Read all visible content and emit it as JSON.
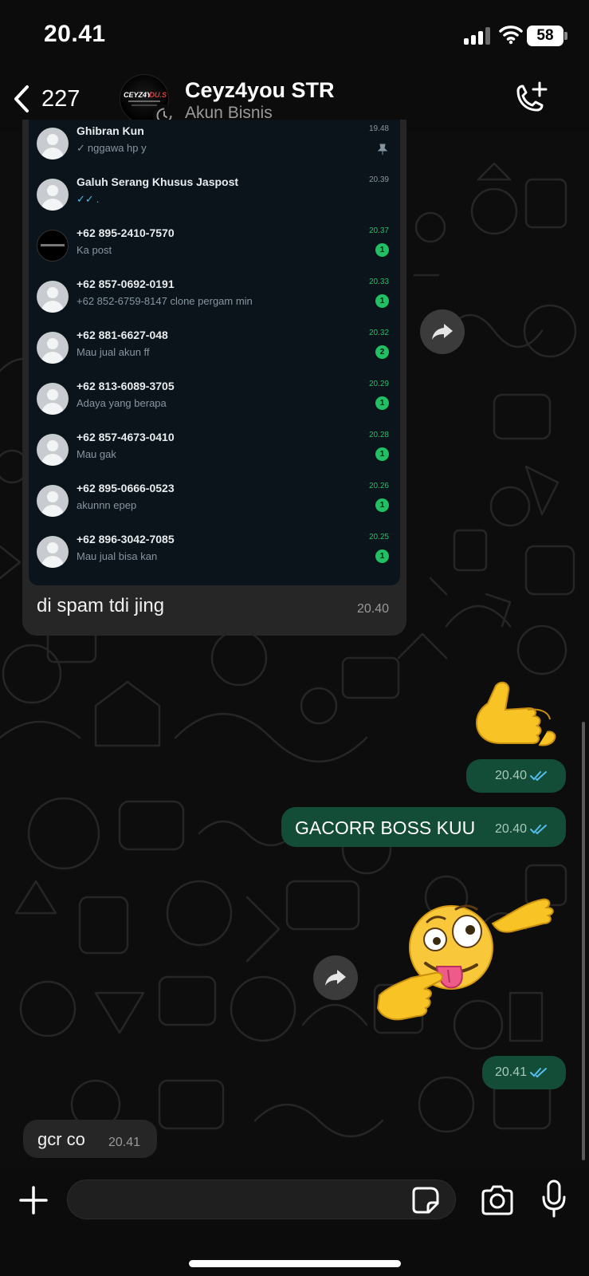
{
  "status_bar": {
    "time": "20.41",
    "battery": "58"
  },
  "header": {
    "back_count": "227",
    "contact_name": "Ceyz4you STR",
    "contact_subtitle": "Akun Bisnis"
  },
  "incoming_image": {
    "rows": [
      {
        "name": "Ghibran Kun",
        "tick": "✓",
        "message": "nggawa hp y",
        "time": "19.48",
        "badge": "",
        "pinned": true,
        "avatar": "default"
      },
      {
        "name": "Galuh Serang Khusus Jaspost",
        "tick": "✓✓",
        "message": ".",
        "time": "20.39",
        "badge": "",
        "pinned": false,
        "avatar": "default"
      },
      {
        "name": "+62 895-2410-7570",
        "tick": "",
        "message": "Ka post",
        "time": "20.37",
        "badge": "1",
        "pinned": false,
        "avatar": "logo"
      },
      {
        "name": "+62 857-0692-0191",
        "tick": "",
        "message": "+62 852-6759-8147 clone pergam min",
        "time": "20.33",
        "badge": "1",
        "pinned": false,
        "avatar": "default"
      },
      {
        "name": "+62 881-6627-048",
        "tick": "",
        "message": "Mau jual akun ff",
        "time": "20.32",
        "badge": "2",
        "pinned": false,
        "avatar": "default"
      },
      {
        "name": "+62 813-6089-3705",
        "tick": "",
        "message": "Adaya yang berapa",
        "time": "20.29",
        "badge": "1",
        "pinned": false,
        "avatar": "default"
      },
      {
        "name": "+62 857-4673-0410",
        "tick": "",
        "message": "Mau gak",
        "time": "20.28",
        "badge": "1",
        "pinned": false,
        "avatar": "default"
      },
      {
        "name": "+62 895-0666-0523",
        "tick": "",
        "message": "akunnn epep",
        "time": "20.26",
        "badge": "1",
        "pinned": false,
        "avatar": "default"
      },
      {
        "name": "+62 896-3042-7085",
        "tick": "",
        "message": "Mau jual bisa kan",
        "time": "20.25",
        "badge": "1",
        "pinned": false,
        "avatar": "default"
      }
    ],
    "caption": "di spam tdi jing",
    "time": "20.40"
  },
  "messages": {
    "sticker1_time": "20.40",
    "text_out": "GACORR BOSS KUU",
    "text_out_time": "20.40",
    "sticker2_time": "20.41",
    "text_in": "gcr co",
    "text_in_time": "20.41"
  },
  "icons": {
    "back": "chevron-left-icon",
    "call_add": "phone-plus-icon",
    "forward": "forward-arrow-icon",
    "read_receipt": "double-check-icon",
    "plus": "plus-icon",
    "sticker": "sticker-icon",
    "camera": "camera-icon",
    "mic": "microphone-icon"
  },
  "colors": {
    "outgoing_bubble": "#144d37",
    "incoming_bubble": "#262626",
    "read_tick": "#53bdeb",
    "unread_badge": "#21c063"
  },
  "input": {
    "placeholder": ""
  }
}
